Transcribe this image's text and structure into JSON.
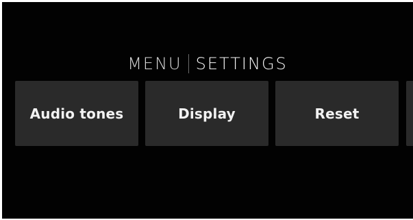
{
  "header": {
    "menu_label": "MENU",
    "settings_label": "SETTINGS"
  },
  "tiles": [
    {
      "label": "Audio tones"
    },
    {
      "label": "Display"
    },
    {
      "label": "Reset"
    },
    {
      "label": ""
    }
  ],
  "colors": {
    "background": "#020202",
    "tile": "#2a2a2a",
    "text": "#f2f2f2"
  }
}
